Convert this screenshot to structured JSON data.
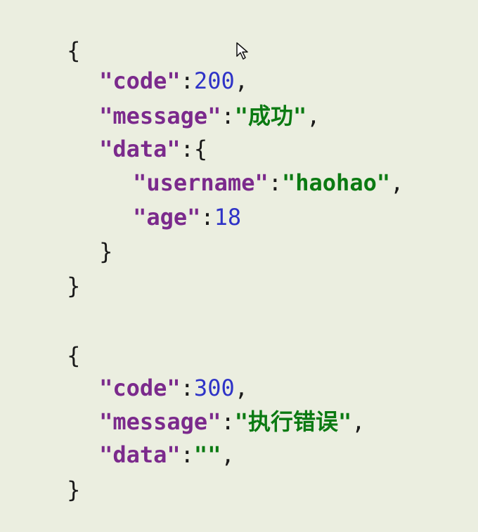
{
  "block1": {
    "open": "{",
    "code_key": "\"code\"",
    "code_value": "200",
    "message_key": "\"message\"",
    "message_value": "\"成功\"",
    "data_key": "\"data\"",
    "data_open": "{",
    "username_key": "\"username\"",
    "username_value": "\"haohao\"",
    "age_key": "\"age\"",
    "age_value": "18",
    "data_close": "}",
    "close": "}"
  },
  "block2": {
    "open": "{",
    "code_key": "\"code\"",
    "code_value": "300",
    "message_key": "\"message\"",
    "message_value": "\"执行错误\"",
    "data_key": "\"data\"",
    "data_value": "\"\"",
    "close": "}"
  },
  "syntax": {
    "colon": ":",
    "comma": ","
  },
  "colors": {
    "background": "#ebeee0",
    "key": "#7b2a8c",
    "string": "#0b7a12",
    "number": "#2e33c7"
  },
  "icons": {
    "cursor": "mouse-pointer-icon"
  }
}
